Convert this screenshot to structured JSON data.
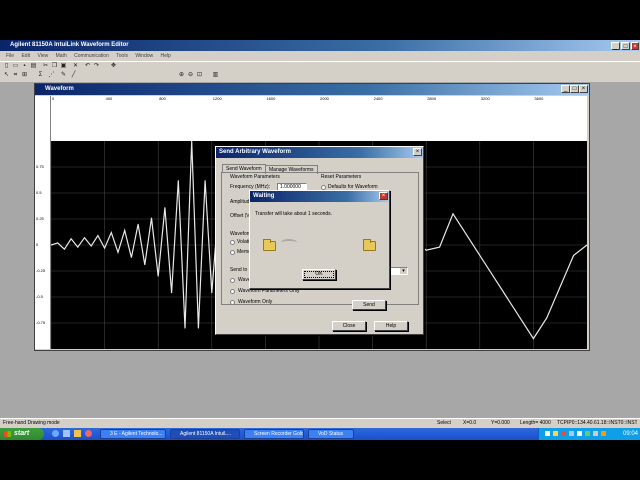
{
  "app": {
    "title": "Agilent 81150A IntuiLink Waveform Editor",
    "menu": [
      "File",
      "Edit",
      "View",
      "Math",
      "Communication",
      "Tools",
      "Window",
      "Help"
    ],
    "status_left": "Free-hand Drawing mode",
    "status_items": [
      "Select",
      "X=0.0",
      "Y=0.000",
      "Length= 4000",
      "TCPIP0::134.40.61.18::INST0::INSTR"
    ]
  },
  "waveform_window": {
    "title": "Waveform",
    "x_ticks": [
      "0",
      "400",
      "800",
      "1200",
      "1600",
      "2000",
      "2400",
      "2800",
      "3200",
      "3600"
    ],
    "y_ticks": [
      "0.75",
      "0.5",
      "0.25",
      "0",
      "-0.25",
      "-0.5",
      "-0.75"
    ]
  },
  "send_dialog": {
    "title": "Send Arbitrary Waveform",
    "tabs": [
      "Send Waveform",
      "Manage Waveforms"
    ],
    "group_params": "Waveform Parameters",
    "group_reset": "Reset Parameters",
    "freq_label": "Frequency (MHz):",
    "freq_value": "1.000000",
    "reset_option": "Defaults for Waveform",
    "ampl_label": "Amplitude",
    "offset_label": "Offset (V)",
    "group_wave": "Waveform",
    "volatile_label": "Volatile",
    "memory_label": "Memory",
    "send_to_label": "Send to",
    "opt_wave_params": "Waveform and Parameters",
    "opt_params_only": "Waveform Parameters Only",
    "opt_wave_only": "Waveform Only",
    "send_btn": "Send",
    "close_btn": "Close",
    "help_btn": "Help"
  },
  "waiting_dialog": {
    "title": "Waiting",
    "message": "Transfer will take about 1 seconds.",
    "ok_btn": "OK"
  },
  "taskbar": {
    "start_label": "start",
    "tasks": [
      "3 E - Agilent Technolo...",
      "Agilent 81150A IntuiL...",
      "Screen Recorder Gold",
      "VoD Status"
    ],
    "clock": "09:04"
  },
  "chart_data": {
    "type": "line",
    "title": "",
    "xlabel": "",
    "ylabel": "",
    "xlim": [
      0,
      4000
    ],
    "ylim": [
      -1,
      1
    ],
    "grid": true,
    "series": [
      {
        "x": [
          0,
          50,
          100,
          150,
          200,
          250,
          300,
          350,
          400,
          450,
          500,
          550,
          600,
          650,
          700,
          750,
          800,
          850,
          900,
          950,
          1000,
          1050,
          1100,
          1150,
          1200,
          1250,
          1300,
          1350,
          1400,
          1450,
          1500,
          1550,
          1600,
          1650,
          1700,
          1750,
          1800,
          1850,
          1900,
          1950,
          2000,
          2050,
          2100,
          2150,
          2200,
          2250,
          2300,
          2350,
          2400,
          2500,
          2600,
          2700,
          2800,
          2900,
          3000,
          3100,
          3200,
          3300,
          3400,
          3500,
          3600,
          3700,
          3800,
          3900,
          4000
        ],
        "y": [
          0.0,
          0.02,
          -0.04,
          0.06,
          -0.02,
          0.07,
          -0.01,
          0.09,
          -0.03,
          0.12,
          -0.07,
          0.14,
          -0.12,
          0.2,
          -0.19,
          0.26,
          -0.3,
          0.36,
          -0.46,
          0.62,
          -0.8,
          1.0,
          -0.8,
          0.62,
          -0.46,
          0.36,
          -0.3,
          0.26,
          -0.19,
          0.2,
          -0.12,
          0.14,
          -0.07,
          0.12,
          -0.03,
          0.09,
          -0.01,
          0.07,
          -0.02,
          0.06,
          -0.04,
          0.02,
          0.0,
          -0.06,
          0.02,
          0.04,
          -0.05,
          0.03,
          0.0,
          -0.06,
          0.02,
          0.04,
          -0.05,
          -0.02,
          0.3,
          0.1,
          -0.1,
          -0.3,
          -0.5,
          -0.7,
          -0.9,
          -0.7,
          -0.4,
          -0.1,
          0.0
        ]
      }
    ]
  }
}
